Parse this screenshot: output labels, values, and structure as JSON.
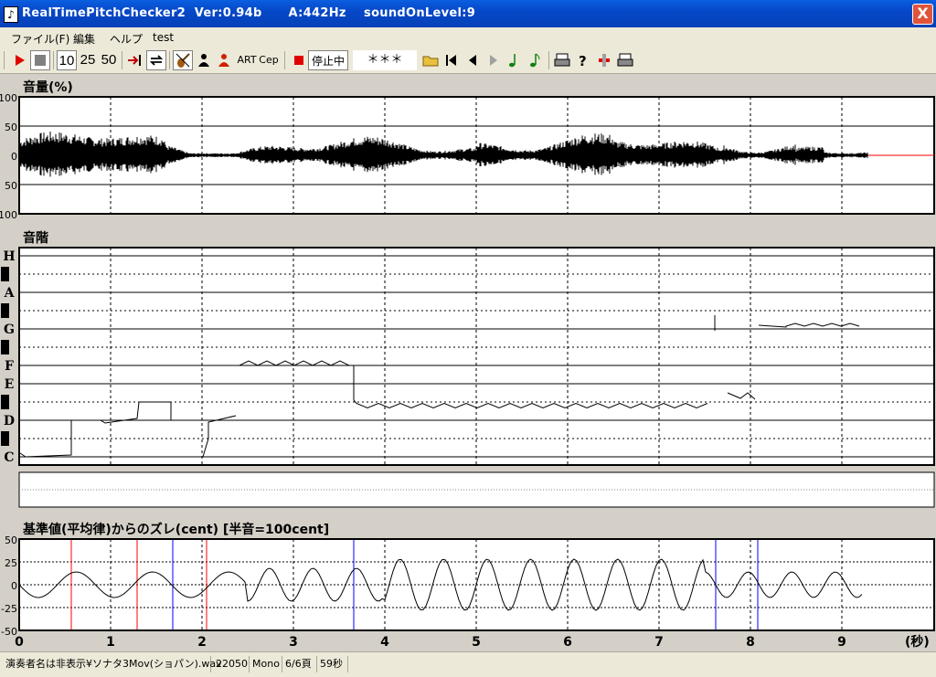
{
  "window": {
    "title": "RealTimePitchChecker2  Ver:0.94b      A:442Hz    soundOnLevel:9",
    "close_label": "X"
  },
  "menu": [
    "ファイル(F)",
    "編集",
    "ヘルプ",
    "test"
  ],
  "toolbar": {
    "speed_options": [
      "10",
      "25",
      "50"
    ],
    "art_label": "ART",
    "cep_label": "Cep",
    "status_label": "停止中",
    "display_value": "＊＊＊"
  },
  "volume_panel": {
    "title": "音量(%)",
    "y_ticks": [
      "100",
      "50",
      "0",
      "50",
      "100"
    ]
  },
  "scale_panel": {
    "title": "音階",
    "notes": [
      "H",
      "A",
      "G",
      "F",
      "E",
      "D",
      "C"
    ]
  },
  "cent_panel": {
    "title": "基準値(平均律)からのズレ(cent) [半音=100cent]",
    "y_ticks": [
      "50",
      "25",
      "0",
      "-25",
      "-50"
    ]
  },
  "time_axis": {
    "ticks": [
      "0",
      "1",
      "2",
      "3",
      "4",
      "5",
      "6",
      "7",
      "8",
      "9"
    ],
    "unit": "(秒)"
  },
  "status_bar": [
    "演奏者名は非表示¥ソナタ3Mov(ショパン).wav",
    "22050",
    "Mono",
    "6/6頁",
    "59秒"
  ],
  "colors": {
    "title_bar": "#0648c8",
    "waveform": "#000000",
    "silence_line": "#ff0000",
    "onset_red": "#ff0000",
    "onset_blue": "#0000ff"
  },
  "icons": [
    "play-icon",
    "stop-icon",
    "jump-icon",
    "loop-icon",
    "violin-icon",
    "person-icon",
    "person-red-icon",
    "record-icon",
    "folder-icon",
    "first-icon",
    "prev-icon",
    "next-icon",
    "note-icon",
    "note2-icon",
    "print-icon",
    "help-icon",
    "marker-icon",
    "print2-icon"
  ]
}
